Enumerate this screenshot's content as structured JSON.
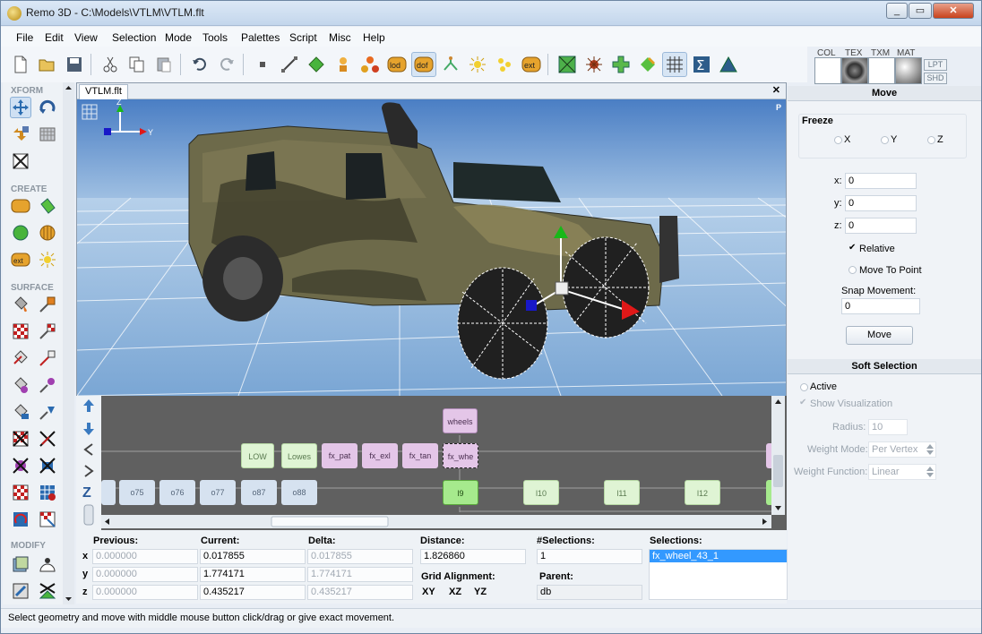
{
  "window": {
    "title": "Remo 3D - C:\\Models\\VTLM\\VTLM.flt",
    "min": "_",
    "max": "▭",
    "close": "✕"
  },
  "menu": [
    "File",
    "Edit",
    "View",
    "Selection",
    "Mode",
    "Tools",
    "Palettes",
    "Script",
    "Misc",
    "Help"
  ],
  "toolbar": {
    "icons": [
      "new-file",
      "open-folder",
      "save",
      "cut",
      "copy",
      "paste",
      "undo",
      "redo",
      "vertex",
      "edge",
      "face",
      "object",
      "group",
      "lod",
      "dof",
      "switch",
      "light-point",
      "light-points",
      "ext-ref",
      "bsp",
      "sound",
      "clip",
      "texture",
      "grid",
      "sigma",
      "triangle"
    ],
    "labels": {
      "lod": "lod",
      "dof": "dof",
      "ext": "ext"
    }
  },
  "materials": {
    "labels": [
      "COL",
      "TEX",
      "TXM",
      "MAT"
    ],
    "lpt": "LPT",
    "shd": "SHD"
  },
  "left_panel": {
    "sections": [
      "XFORM",
      "CREATE",
      "SURFACE",
      "MODIFY"
    ],
    "create_ext": "ext"
  },
  "viewport": {
    "tab": "VTLM.flt",
    "close": "✕",
    "axis_z": "Z",
    "axis_y": "Y",
    "persp": "P"
  },
  "graph": {
    "nodes": [
      {
        "label": "wheels",
        "row": 0
      },
      {
        "label": "LOW",
        "row": 1
      },
      {
        "label": "Lowes",
        "row": 1
      },
      {
        "label": "fx_pat",
        "row": 1
      },
      {
        "label": "fx_exl",
        "row": 1
      },
      {
        "label": "fx_tan",
        "row": 1
      },
      {
        "label": "fx_whe",
        "row": 1
      },
      {
        "label": "o75",
        "row": 2
      },
      {
        "label": "o76",
        "row": 2
      },
      {
        "label": "o77",
        "row": 2
      },
      {
        "label": "o87",
        "row": 2
      },
      {
        "label": "o88",
        "row": 2
      },
      {
        "label": "l9",
        "row": 2
      },
      {
        "label": "l10",
        "row": 2
      },
      {
        "label": "l11",
        "row": 2
      },
      {
        "label": "l12",
        "row": 2
      }
    ]
  },
  "move_panel": {
    "header": "Move",
    "freeze": "Freeze",
    "fx": "X",
    "fy": "Y",
    "fz": "Z",
    "x_label": "x:",
    "x_val": "0",
    "y_label": "y:",
    "y_val": "0",
    "z_label": "z:",
    "z_val": "0",
    "relative": "Relative",
    "move_to_point": "Move To Point",
    "snap_label": "Snap Movement:",
    "snap_val": "0",
    "move_button": "Move"
  },
  "soft_panel": {
    "header": "Soft Selection",
    "active": "Active",
    "show_vis": "Show Visualization",
    "radius_label": "Radius:",
    "radius_val": "10",
    "weight_mode_label": "Weight Mode:",
    "weight_mode_val": "Per Vertex",
    "weight_fn_label": "Weight Function:",
    "weight_fn_val": "Linear"
  },
  "bottom": {
    "previous": "Previous:",
    "current": "Current:",
    "delta": "Delta:",
    "rows": [
      {
        "axis": "x",
        "prev": "0.000000",
        "cur": "0.017855",
        "delta": "0.017855"
      },
      {
        "axis": "y",
        "prev": "0.000000",
        "cur": "1.774171",
        "delta": "1.774171"
      },
      {
        "axis": "z",
        "prev": "0.000000",
        "cur": "0.435217",
        "delta": "0.435217"
      }
    ],
    "distance_label": "Distance:",
    "distance_val": "1.826860",
    "grid_label": "Grid Alignment:",
    "grid_buttons": [
      "XY",
      "XZ",
      "YZ"
    ],
    "nsel_label": "#Selections:",
    "nsel_val": "1",
    "parent_label": "Parent:",
    "parent_val": "db",
    "sel_label": "Selections:",
    "sel_item": "fx_wheel_43_1"
  },
  "status": "Select geometry and move with middle mouse button click/drag or give exact movement."
}
